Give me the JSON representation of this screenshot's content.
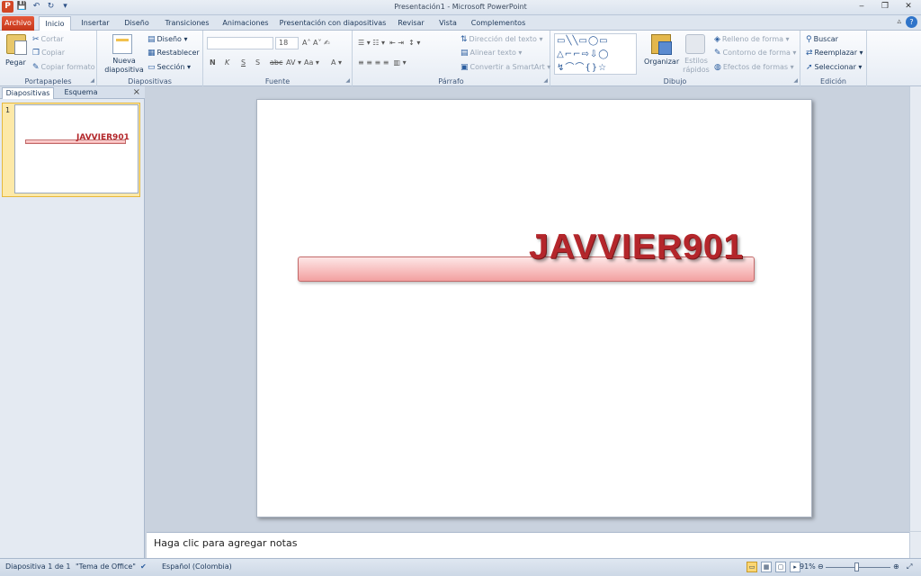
{
  "window": {
    "title": "Presentación1  -  Microsoft PowerPoint"
  },
  "qat": {
    "save": "💾",
    "undo": "↶",
    "redo": "↻",
    "customize": "▾"
  },
  "tabs": [
    "Archivo",
    "Inicio",
    "Insertar",
    "Diseño",
    "Transiciones",
    "Animaciones",
    "Presentación con diapositivas",
    "Revisar",
    "Vista",
    "Complementos"
  ],
  "ribbon": {
    "clipboard": {
      "paste": "Pegar",
      "cut": "Cortar",
      "copy": "Copiar",
      "format_painter": "Copiar formato",
      "label": "Portapapeles"
    },
    "slides": {
      "new_slide": "Nueva diapositiva",
      "layout": "Diseño",
      "reset": "Restablecer",
      "section": "Sección",
      "label": "Diapositivas"
    },
    "font": {
      "font_size": "18",
      "bold": "N",
      "italic": "K",
      "underline": "S",
      "strike": "abc",
      "label": "Fuente"
    },
    "paragraph": {
      "text_direction": "Dirección del texto",
      "align_text": "Alinear texto",
      "smartart": "Convertir a SmartArt",
      "label": "Párrafo"
    },
    "drawing": {
      "arrange": "Organizar",
      "quick_styles": "Estilos rápidos",
      "shape_fill": "Relleno de forma",
      "shape_outline": "Contorno de forma",
      "shape_effects": "Efectos de formas",
      "label": "Dibujo"
    },
    "editing": {
      "find": "Buscar",
      "replace": "Reemplazar",
      "select": "Seleccionar",
      "label": "Edición"
    }
  },
  "panel": {
    "tab_slides": "Diapositivas",
    "tab_outline": "Esquema",
    "close": "×",
    "slide_number": "1"
  },
  "slide": {
    "text": "JAVVIER901"
  },
  "notes": {
    "placeholder": "Haga clic para agregar notas"
  },
  "status": {
    "slide_count": "Diapositiva 1 de 1",
    "theme": "\"Tema de Office\"",
    "language": "Español (Colombia)",
    "zoom": "91%"
  },
  "colors": {
    "file_tab": "#d24726",
    "slide_text": "#b4262b"
  }
}
